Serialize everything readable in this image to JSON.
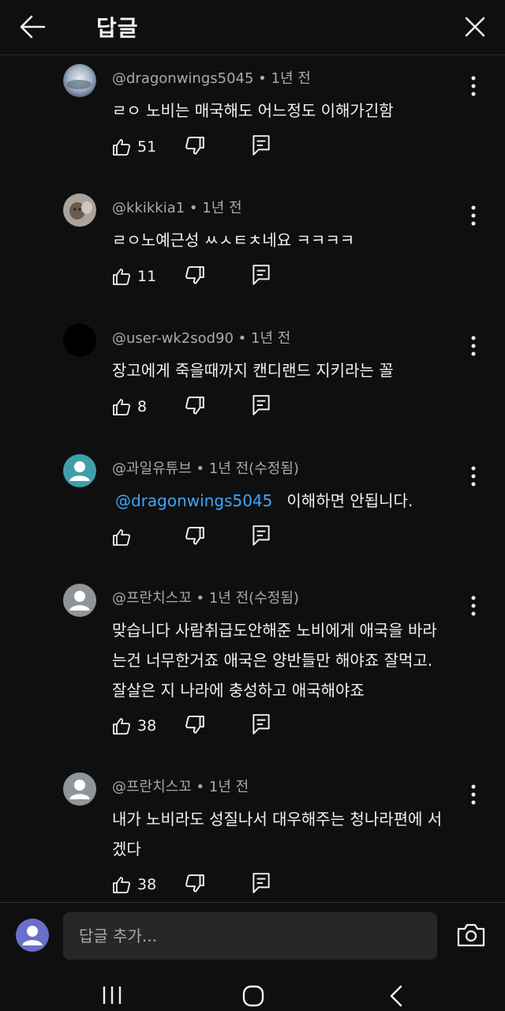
{
  "header": {
    "title": "답글"
  },
  "comments": [
    {
      "handle": "@dragonwings5045",
      "time": "1년 전",
      "edited": "",
      "text": "ㄹㅇ 노비는 매국해도 어느정도 이해가긴함",
      "mention": "",
      "likes": "51",
      "avatar": "photo-sky"
    },
    {
      "handle": "@kkikkia1",
      "time": "1년 전",
      "edited": "",
      "text": "ㄹㅇ노예근성 ㅆㅅㅌㅊ네요 ㅋㅋㅋㅋ",
      "mention": "",
      "likes": "11",
      "avatar": "photo-cat"
    },
    {
      "handle": "@user-wk2sod90",
      "time": "1년 전",
      "edited": "",
      "text": "장고에게 죽을때까지 캔디랜드 지키라는 꼴",
      "mention": "",
      "likes": "8",
      "avatar": "black"
    },
    {
      "handle": "@과일유튜브",
      "time": "1년 전",
      "edited": "(수정됨)",
      "text": "이해하면 안됩니다.",
      "mention": "@dragonwings5045",
      "likes": "",
      "avatar": "default-teal"
    },
    {
      "handle": "@프란치스꼬",
      "time": "1년 전",
      "edited": "(수정됨)",
      "text": "맞습니다 사람취급도안해준 노비에게 애국을 바라는건 너무한거죠 애국은 양반들만 해야죠 잘먹고. 잘살은 지 나라에 충성하고 애국해야죠",
      "mention": "",
      "likes": "38",
      "avatar": "default-gray"
    },
    {
      "handle": "@프란치스꼬",
      "time": "1년 전",
      "edited": "",
      "text": "내가 노비라도 성질나서 대우해주는 청나라편에 서겠다",
      "mention": "",
      "likes": "38",
      "avatar": "default-gray"
    }
  ],
  "input": {
    "placeholder": "답글 추가..."
  },
  "colors": {
    "background": "#0f0f0f",
    "secondary_text": "#aaaaaa",
    "mention": "#3ea6ff",
    "input_bg": "#272727"
  },
  "icons": [
    "back-arrow-icon",
    "close-icon",
    "more-vert-icon",
    "thumb-up-icon",
    "thumb-down-icon",
    "reply-icon",
    "camera-icon",
    "recent-apps-icon",
    "home-icon",
    "back-nav-icon"
  ]
}
